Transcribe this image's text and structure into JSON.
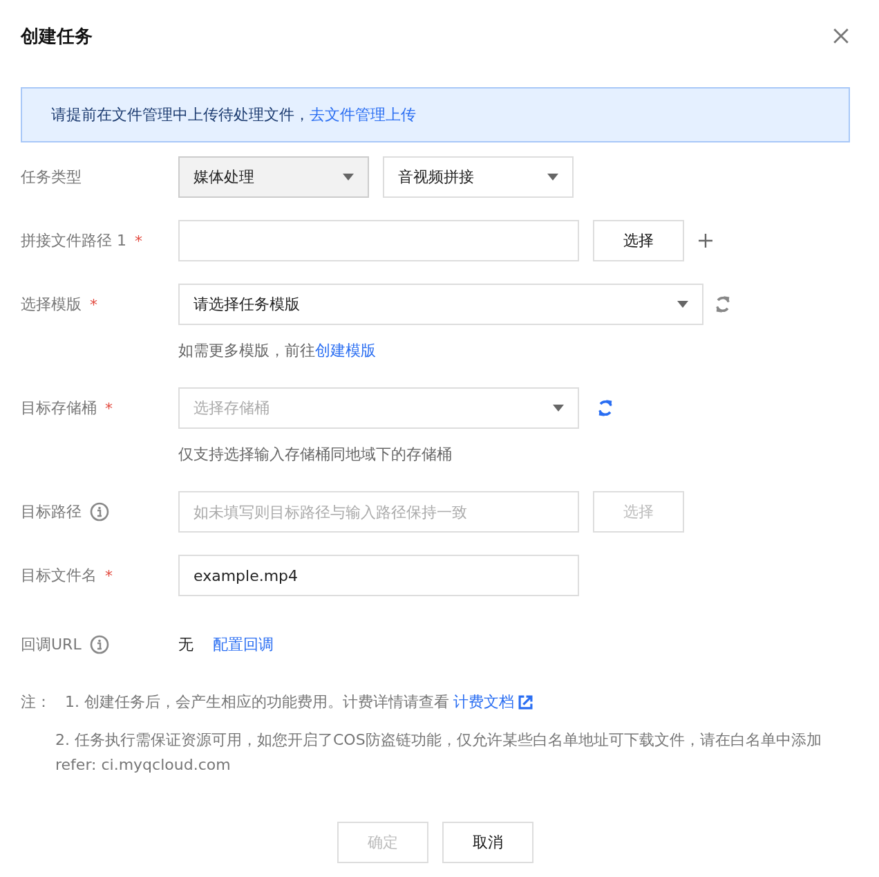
{
  "dialog": {
    "title": "创建任务"
  },
  "notice": {
    "text": "请提前在文件管理中上传待处理文件，",
    "link": "去文件管理上传"
  },
  "fields": [
    {
      "kind": "selects",
      "label": "任务类型",
      "selects": [
        {
          "value": "媒体处理",
          "disabled": true
        },
        {
          "value": "音视频拼接",
          "disabled": false
        }
      ]
    },
    {
      "kind": "input-button",
      "label": "拼接文件路径 1",
      "required_mark": "*",
      "button": "选择",
      "button_disabled": false,
      "addable": true
    },
    {
      "kind": "select",
      "label": "选择模版",
      "required_mark": "*",
      "value": "请选择任务模版",
      "refresh_active": false,
      "hint": "如需更多模版，前往",
      "hint_link": "创建模版"
    },
    {
      "kind": "select",
      "label": "目标存储桶",
      "required_mark": "*",
      "placeholder": "选择存储桶",
      "refresh_active": true,
      "hint": "仅支持选择输入存储桶同地域下的存储桶"
    },
    {
      "kind": "input-button",
      "label": "目标路径",
      "info": true,
      "placeholder": "如未填写则目标路径与输入路径保持一致",
      "button": "选择",
      "button_disabled": true
    },
    {
      "kind": "input",
      "label": "目标文件名",
      "required_mark": "*",
      "value": "example.mp4"
    },
    {
      "kind": "text",
      "label": "回调URL",
      "info": true,
      "value": "无",
      "link": "配置回调"
    }
  ],
  "notes": {
    "label": "注：",
    "items": [
      {
        "text": "1. 创建任务后，会产生相应的功能费用。计费详情请查看",
        "link": "计费文档"
      },
      {
        "text": "2. 任务执行需保证资源可用，如您开启了COS防盗链功能，仅允许某些白名单地址可下载文件，请在白名单中添加refer: ci.myqcloud.com"
      }
    ]
  },
  "buttons": [
    {
      "label": "确定",
      "disabled": true
    },
    {
      "label": "取消",
      "disabled": false
    }
  ]
}
